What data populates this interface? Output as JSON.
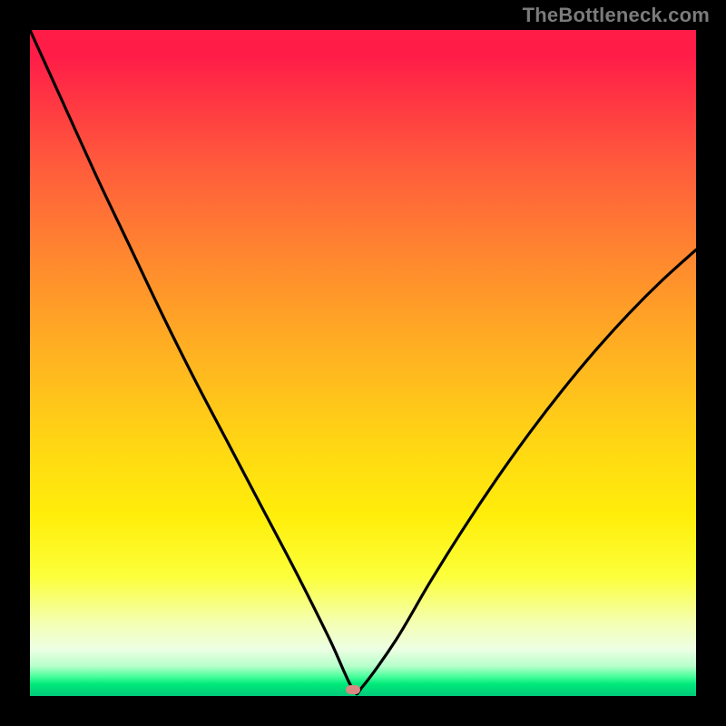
{
  "watermark": "TheBottleneck.com",
  "chart_data": {
    "type": "line",
    "title": "",
    "xlabel": "",
    "ylabel": "",
    "xlim": [
      0,
      100
    ],
    "ylim": [
      0,
      100
    ],
    "grid": false,
    "series": [
      {
        "name": "bottleneck-curve",
        "x": [
          0,
          5,
          10,
          15,
          20,
          25,
          30,
          35,
          40,
          45,
          48.5,
          50,
          55,
          60,
          65,
          70,
          75,
          80,
          85,
          90,
          95,
          100
        ],
        "y": [
          100,
          89,
          78,
          67.5,
          57,
          47,
          37.5,
          28,
          18.5,
          8.5,
          1.0,
          1.5,
          8.5,
          17,
          25,
          32.5,
          39.5,
          46,
          52,
          57.5,
          62.5,
          67
        ]
      }
    ],
    "annotations": {
      "minimum_point": {
        "x": 48.5,
        "y": 1.0
      }
    },
    "gradient_stops": [
      {
        "pos": 0.0,
        "color": "#ff1d48"
      },
      {
        "pos": 0.2,
        "color": "#ff5a3c"
      },
      {
        "pos": 0.48,
        "color": "#ffb022"
      },
      {
        "pos": 0.73,
        "color": "#ffee0a"
      },
      {
        "pos": 0.93,
        "color": "#ecffe4"
      },
      {
        "pos": 1.0,
        "color": "#00c97a"
      }
    ],
    "colors": {
      "curve": "#000000",
      "marker": "#d98982",
      "background_frame": "#000000"
    }
  }
}
